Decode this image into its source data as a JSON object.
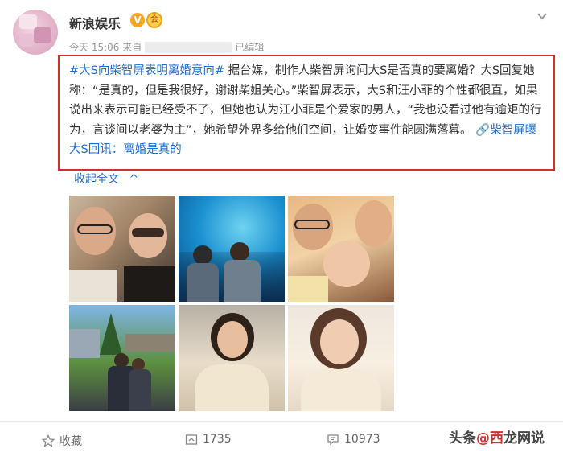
{
  "header": {
    "account_name": "新浪娱乐",
    "verified_mark": "V",
    "member_badge": "会",
    "time_prefix": "今天 15:06 来自",
    "edited_label": "已编辑"
  },
  "post": {
    "hashtag": "#大S向柴智屏表明离婚意向#",
    "body": " 据台媒，制作人柴智屏询问大S是否真的要离婚？大S回复她称：“是真的，但是我很好，谢谢柴姐关心。”柴智屏表示，大S和汪小菲的个性都很直，如果说出来表示可能已经受不了，但她也认为汪小菲是个爱家的男人，“我也没看过他有逾矩的行为，言谈间以老婆为主”，她希望外界多给他们空间，让婚变事件能圆满落幕。 ",
    "link_icon": "🔗",
    "link_text": "柴智屏曝大S回讯：离婚是真的"
  },
  "collapse": {
    "label": "收起全文",
    "icon": "^"
  },
  "actions": {
    "favorite_label": "收藏",
    "repost_count": "1735",
    "comment_count": "10973"
  },
  "watermark": {
    "text_left": "头条",
    "text_red": "@西",
    "text_right": "龙网说"
  },
  "colors": {
    "link": "#1e6fcf",
    "highlight_border": "#d32f2f",
    "meta": "#999999"
  },
  "icons": [
    "chevron-down-icon",
    "star-icon",
    "repost-icon",
    "comment-icon",
    "link-icon"
  ]
}
